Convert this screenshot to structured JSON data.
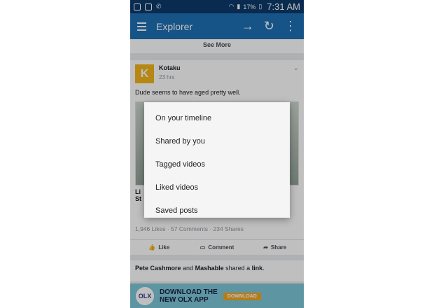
{
  "status_bar": {
    "battery": "17%",
    "time": "7:31 AM"
  },
  "app_bar": {
    "title": "Explorer"
  },
  "feed": {
    "see_more": "See More",
    "post": {
      "page_name": "Kotaku",
      "time": "23 hrs",
      "text": "Dude seems to have aged pretty well.",
      "link_title_fragment": "Li",
      "link_title_fragment2": "St",
      "counts": "1,946 Likes · 57 Comments · 234 Shares",
      "actions": {
        "like": "Like",
        "comment": "Comment",
        "share": "Share"
      }
    },
    "shared": {
      "user1": "Pete Cashmore",
      "and": "and",
      "user2": "Mashable",
      "middle": "shared a",
      "link": "link",
      "end": "."
    }
  },
  "ad": {
    "brand": "OLX",
    "headline_1": "DOWNLOAD THE",
    "headline_2": "NEW OLX APP",
    "button": "DOWNLOAD"
  },
  "menu": {
    "items": [
      "On your timeline",
      "Shared by you",
      "Tagged videos",
      "Liked videos",
      "Saved posts"
    ]
  }
}
